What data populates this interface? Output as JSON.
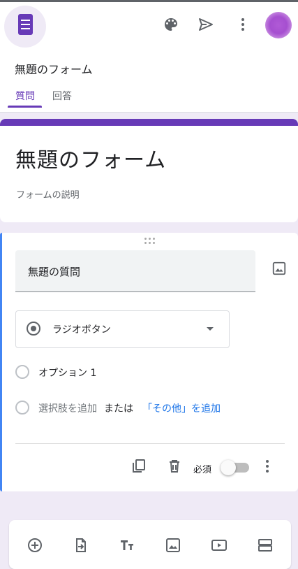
{
  "header": {
    "doc_title": "無題のフォーム",
    "tabs": [
      {
        "label": "質問",
        "active": true
      },
      {
        "label": "回答",
        "active": false
      }
    ],
    "icons": [
      "palette-icon",
      "send-icon",
      "more-vert-icon"
    ]
  },
  "form": {
    "title": "無題のフォーム",
    "description_placeholder": "フォームの説明"
  },
  "question": {
    "title": "無題の質問",
    "type": "ラジオボタン",
    "options": [
      "オプション 1"
    ],
    "add_option": "選択肢を追加",
    "or": "または",
    "add_other": "「その他」を追加",
    "required_label": "必須",
    "required": false
  },
  "toolbar": {
    "icons": [
      "add-question-icon",
      "import-questions-icon",
      "add-title-icon",
      "add-image-icon",
      "add-video-icon",
      "add-section-icon"
    ]
  },
  "colors": {
    "accent": "#673ab7",
    "active_border": "#4285f4",
    "link": "#1a73e8",
    "background": "#efeaf6"
  }
}
